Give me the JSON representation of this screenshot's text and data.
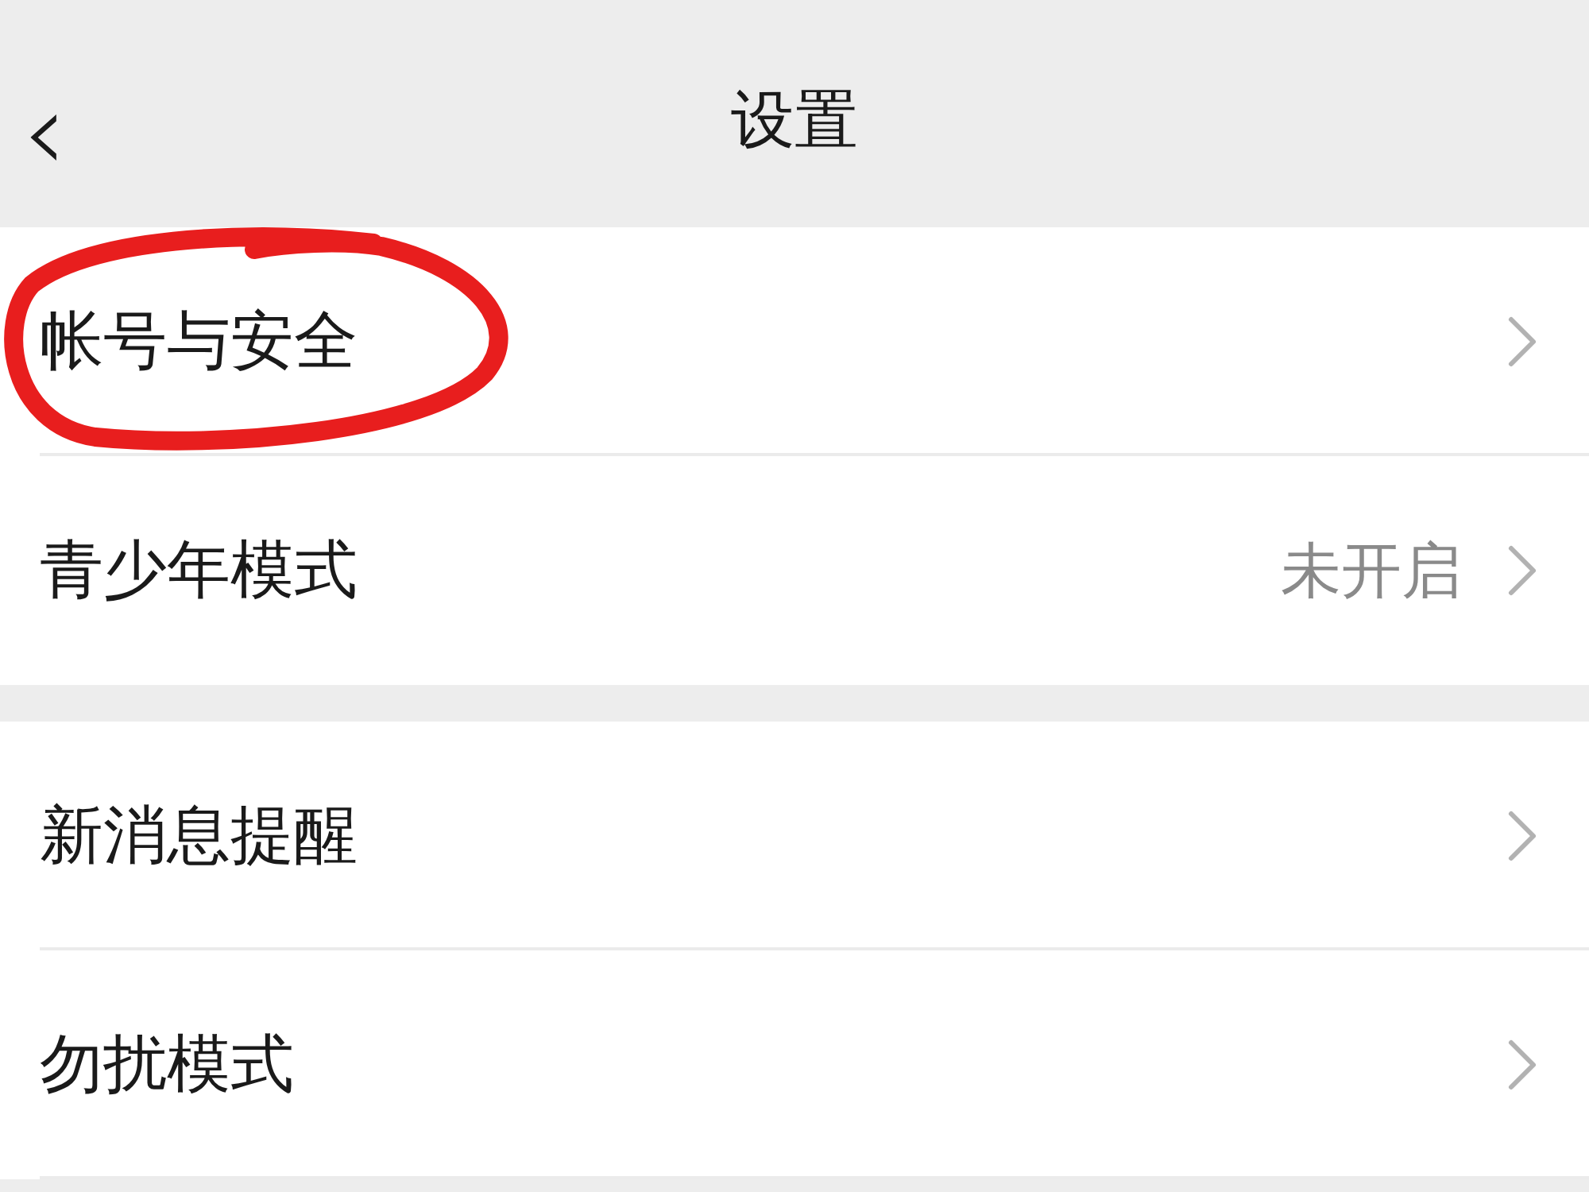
{
  "header": {
    "back": "‹",
    "title": "设置"
  },
  "groups": [
    {
      "items": [
        {
          "label": "帐号与安全",
          "circled": true
        },
        {
          "label": "青少年模式",
          "value": "未开启",
          "circled": false
        }
      ]
    },
    {
      "items": [
        {
          "label": "新消息提醒",
          "circled": false
        },
        {
          "label": "勿扰模式",
          "circled": false
        }
      ]
    }
  ]
}
